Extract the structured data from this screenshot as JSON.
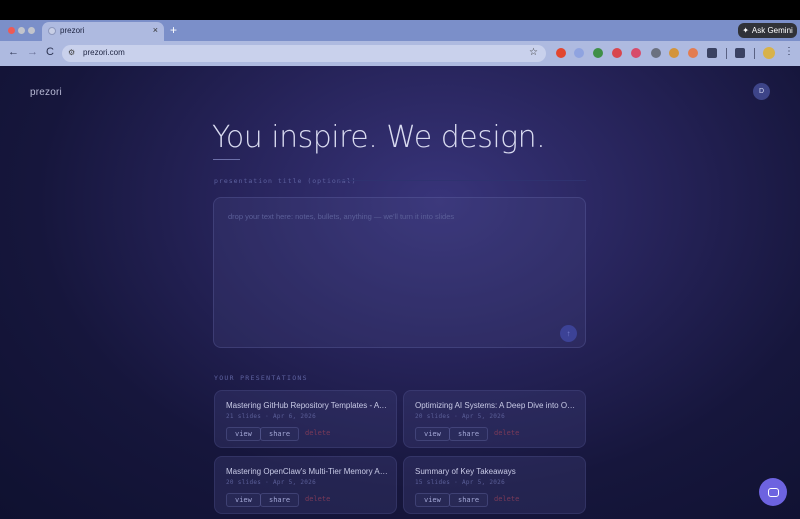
{
  "browser": {
    "tab_title": "prezori",
    "tab_close": "×",
    "new_tab": "+",
    "gemini_label": "Ask Gemini",
    "url": "prezori.com",
    "back": "←",
    "forward": "→",
    "reload": "C",
    "star": "☆",
    "menu": "⋮"
  },
  "app": {
    "brand": "prezori",
    "user_initial": "D",
    "hero_title": "You inspire. We design.",
    "title_field_label": "presentation title (optional)",
    "textarea_placeholder": "drop your text here: notes, bullets, anything — we'll turn it into slides",
    "submit_icon": "↑",
    "presentations_label": "YOUR PRESENTATIONS"
  },
  "presentations": [
    {
      "title": "Mastering GitHub Repository Templates - A Com...",
      "meta": "21 slides · Apr 6, 2026",
      "view": "view",
      "share": "share",
      "delete": "delete"
    },
    {
      "title": "Optimizing AI Systems: A Deep Dive into OpenCl...",
      "meta": "20 slides · Apr 5, 2026",
      "view": "view",
      "share": "share",
      "delete": "delete"
    },
    {
      "title": "Mastering OpenClaw's Multi-Tier Memory Archite...",
      "meta": "20 slides · Apr 5, 2026",
      "view": "view",
      "share": "share",
      "delete": "delete"
    },
    {
      "title": "Summary of Key Takeaways",
      "meta": "15 slides · Apr 5, 2026",
      "view": "view",
      "share": "share",
      "delete": "delete"
    }
  ],
  "colors": {
    "accent": "#6d63e0",
    "chrome": "#aebae0",
    "delete": "#7a3a58"
  },
  "icons": {
    "chat": "chat-bubble-icon",
    "submit": "arrow-up-icon"
  }
}
